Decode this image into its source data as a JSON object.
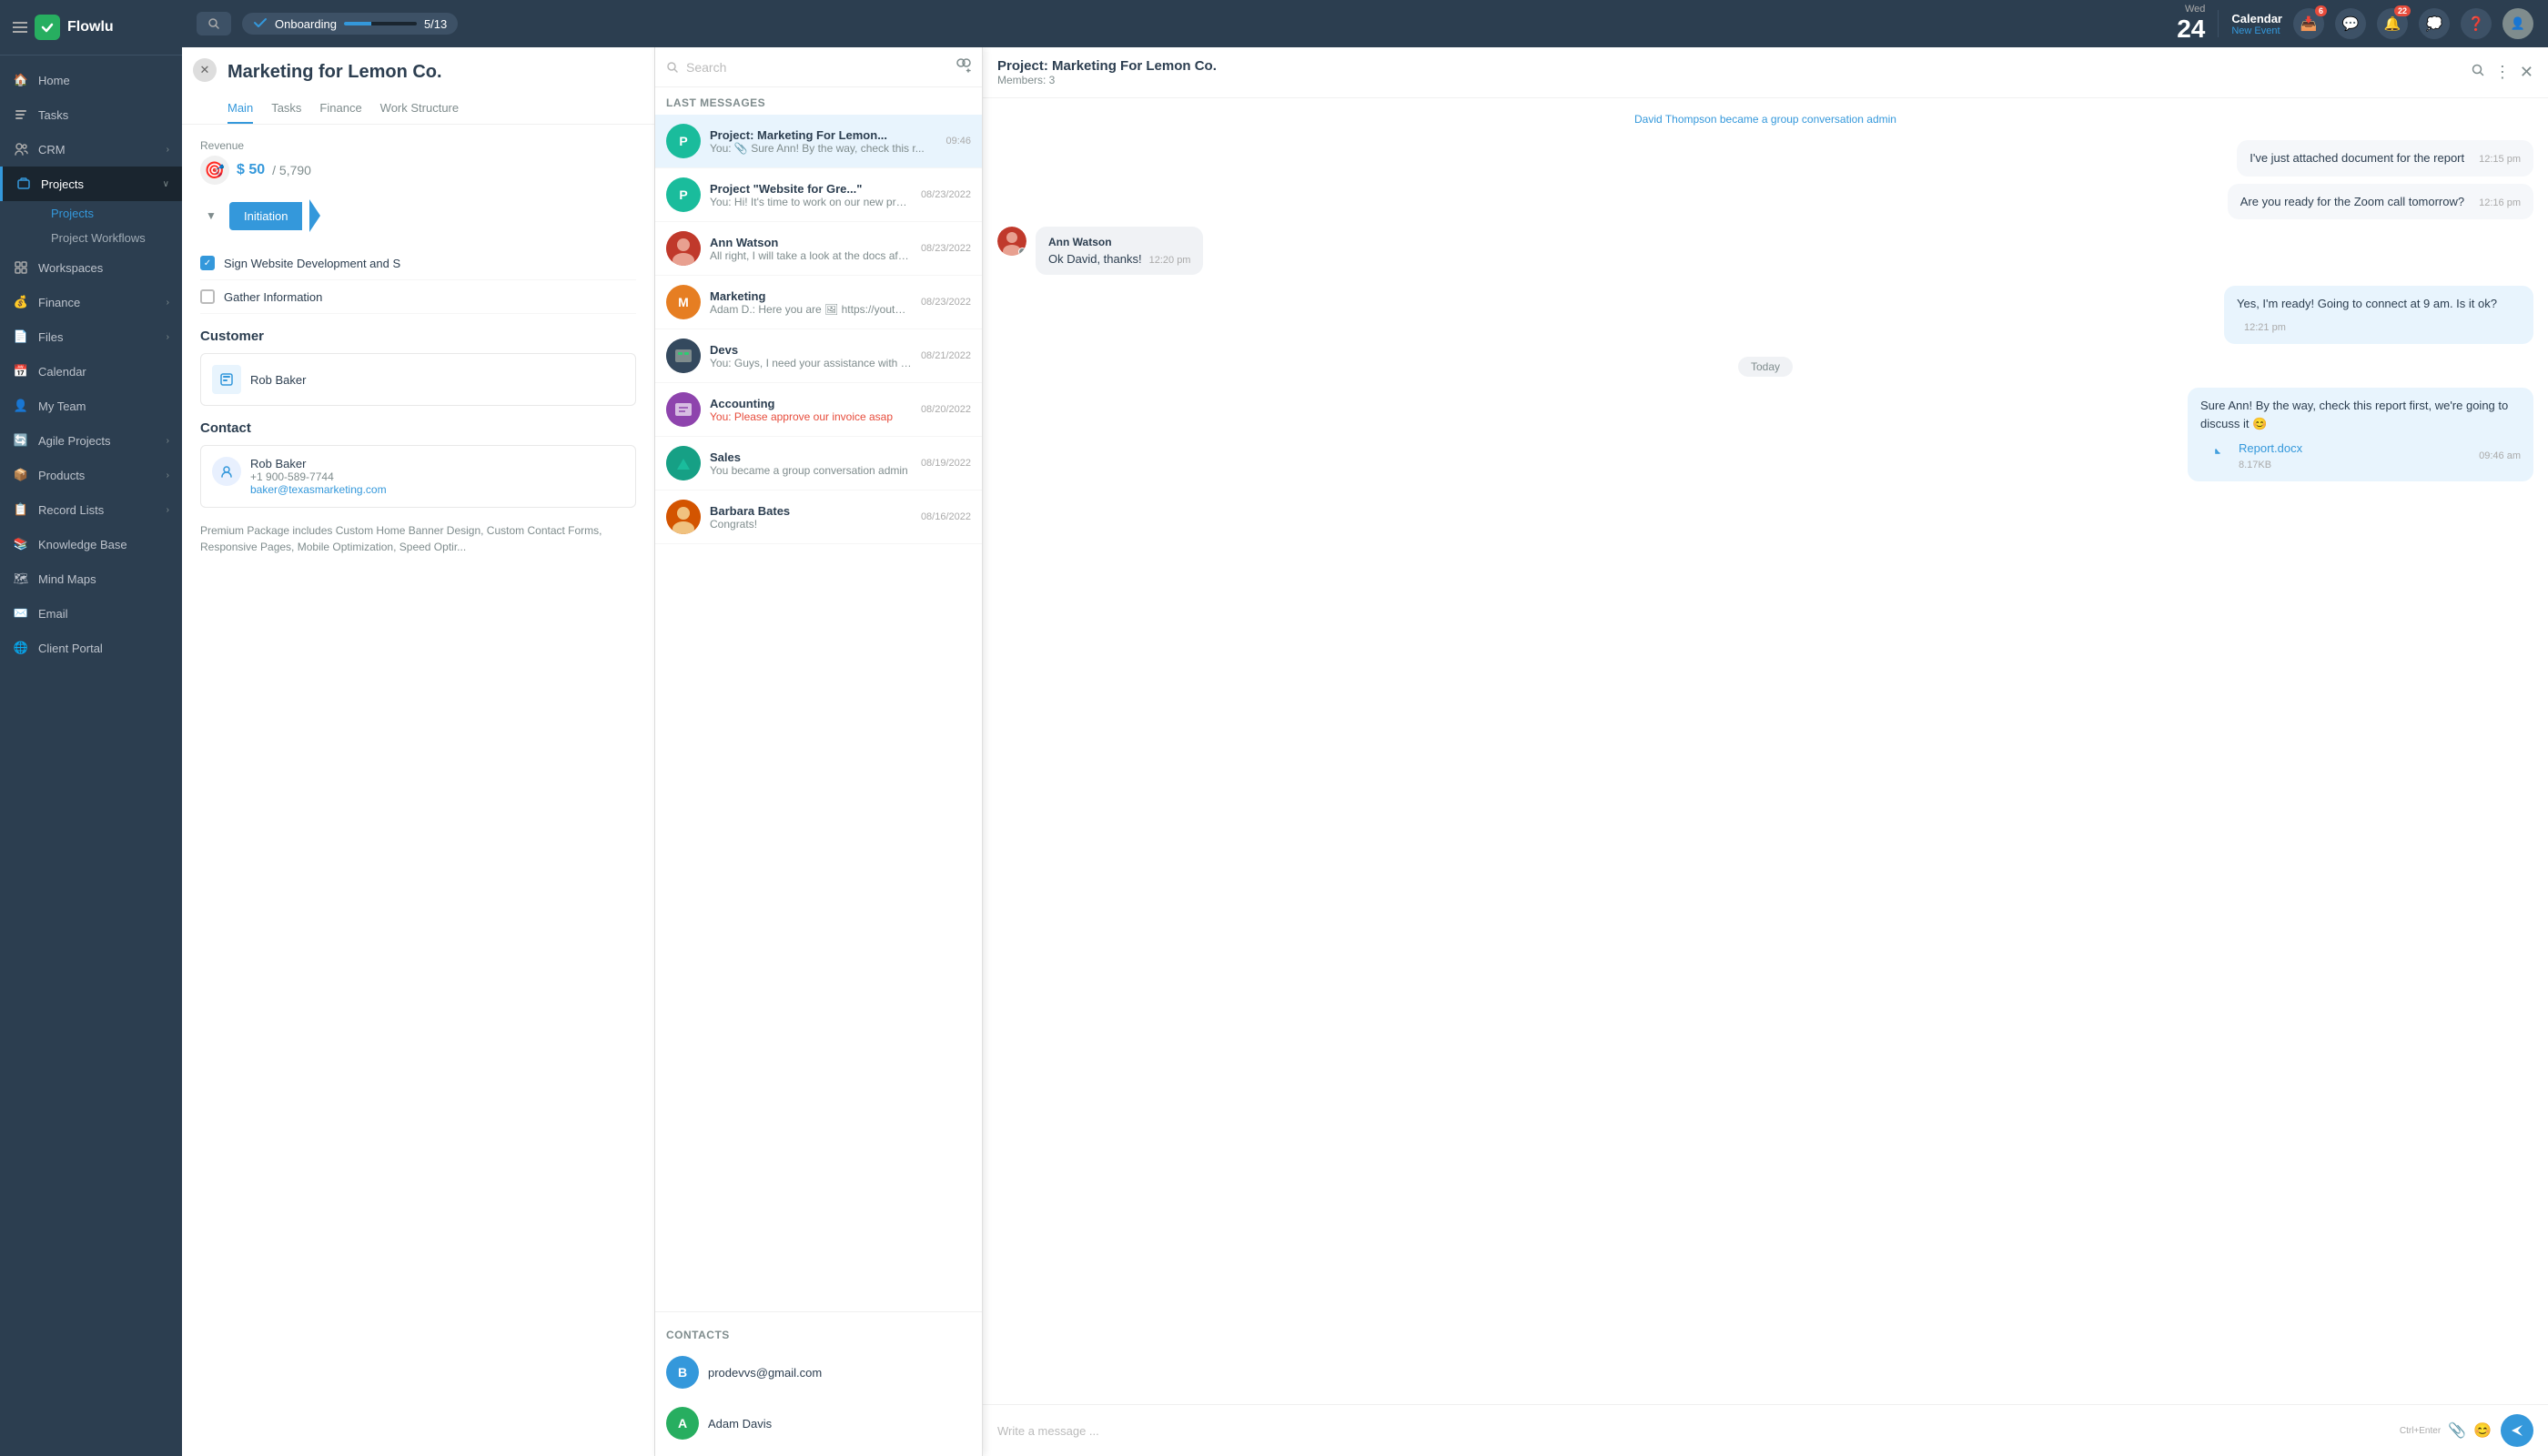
{
  "app": {
    "name": "Flowlu",
    "logo_letter": "✓"
  },
  "topbar": {
    "search_placeholder": "Search",
    "onboarding_label": "Onboarding",
    "onboarding_progress": "5/13",
    "onboarding_pct": 38,
    "calendar_label": "Calendar",
    "calendar_sublabel": "New Event",
    "date_day": "24",
    "date_weekday": "Wed",
    "notif_count": "6",
    "bell_count": "22"
  },
  "sidebar": {
    "items": [
      {
        "id": "home",
        "label": "Home",
        "icon": "🏠"
      },
      {
        "id": "tasks",
        "label": "Tasks",
        "icon": "✓"
      },
      {
        "id": "crm",
        "label": "CRM",
        "icon": "👥"
      },
      {
        "id": "projects",
        "label": "Projects",
        "icon": "📁",
        "active": true,
        "has_sub": true
      },
      {
        "id": "workspaces",
        "label": "Workspaces",
        "icon": "🔲"
      },
      {
        "id": "finance",
        "label": "Finance",
        "icon": "💰"
      },
      {
        "id": "files",
        "label": "Files",
        "icon": "📄"
      },
      {
        "id": "calendar",
        "label": "Calendar",
        "icon": "📅"
      },
      {
        "id": "my-team",
        "label": "My Team",
        "icon": "👤"
      },
      {
        "id": "agile",
        "label": "Agile Projects",
        "icon": "🔄"
      },
      {
        "id": "products",
        "label": "Products",
        "icon": "📦"
      },
      {
        "id": "record-lists",
        "label": "Record Lists",
        "icon": "📋"
      },
      {
        "id": "knowledge-base",
        "label": "Knowledge Base",
        "icon": "📚"
      },
      {
        "id": "mind-maps",
        "label": "Mind Maps",
        "icon": "🗺"
      },
      {
        "id": "email",
        "label": "Email",
        "icon": "✉️"
      },
      {
        "id": "client-portal",
        "label": "Client Portal",
        "icon": "🌐"
      }
    ],
    "sub_items": [
      {
        "id": "projects-sub",
        "label": "Projects",
        "active": false
      },
      {
        "id": "project-workflows",
        "label": "Project Workflows",
        "active": false
      }
    ]
  },
  "project": {
    "title": "Marketing for Lemon Co.",
    "tabs": [
      "Main",
      "Tasks",
      "Finance",
      "Work Structure"
    ],
    "active_tab": "Main",
    "revenue": {
      "label": "Revenue",
      "amount": "$ 50",
      "total": "5,790"
    },
    "stage": "Initiation",
    "tasks": [
      {
        "id": 1,
        "label": "Sign Website Development and S",
        "done": true
      },
      {
        "id": 2,
        "label": "Gather Information",
        "done": false
      }
    ],
    "customer": {
      "label": "Customer",
      "name": "Rob Baker"
    },
    "contact": {
      "label": "Contact",
      "name": "Rob Baker",
      "phone": "+1 900-589-7744",
      "email": "baker@texasmarketing.com"
    },
    "description": "Premium Package includes Custom Home Banner Design, Custom Contact Forms, Responsive Pages, Mobile Optimization, Speed Optir..."
  },
  "messaging": {
    "search_placeholder": "Search",
    "section_label": "Last messages",
    "conversations": [
      {
        "id": 1,
        "name": "Project: Marketing For Lemon...",
        "time": "09:46",
        "preview": "You: 📎 Sure Ann! By the way, check this r...",
        "avatar_letter": "P",
        "avatar_color": "av-teal",
        "active": true
      },
      {
        "id": 2,
        "name": "Project \"Website for Gre...\"",
        "time": "08/23/2022",
        "preview": "You: Hi! It's time to work on our new project!",
        "avatar_letter": "P",
        "avatar_color": "av-teal",
        "active": false
      },
      {
        "id": 3,
        "name": "Ann Watson",
        "time": "08/23/2022",
        "preview": "All right, I will take a look at the docs after ...",
        "avatar_type": "image",
        "active": false
      },
      {
        "id": 4,
        "name": "Marketing",
        "time": "08/23/2022",
        "preview": "Adam D.: Here you are 🖼 https://youtu.b...",
        "avatar_letter": "M",
        "avatar_color": "av-orange",
        "active": false
      },
      {
        "id": 5,
        "name": "Devs",
        "time": "08/21/2022",
        "preview": "You: Guys, I need your assistance with the...",
        "avatar_type": "devs_image",
        "active": false
      },
      {
        "id": 6,
        "name": "Accounting",
        "time": "08/20/2022",
        "preview": "You: Please approve our invoice asap",
        "avatar_type": "accounting_image",
        "active": false
      },
      {
        "id": 7,
        "name": "Sales",
        "time": "08/19/2022",
        "preview": "You became a group conversation admin",
        "avatar_type": "sales_image",
        "active": false
      },
      {
        "id": 8,
        "name": "Barbara Bates",
        "time": "08/16/2022",
        "preview": "Congrats!",
        "avatar_type": "barbara_image",
        "active": false
      }
    ],
    "contacts_section": "Contacts",
    "contacts": [
      {
        "id": 1,
        "name": "prodevvs@gmail.com",
        "avatar_letter": "B",
        "avatar_color": "av-blue"
      },
      {
        "id": 2,
        "name": "Adam Davis",
        "avatar_letter": "A",
        "avatar_color": "av-green"
      }
    ]
  },
  "chat": {
    "title": "Project: Marketing For Lemon Co.",
    "subtitle": "Members: 3",
    "admin_notice_user": "David Thompson",
    "admin_notice_text": "became a group conversation admin",
    "messages": [
      {
        "id": 1,
        "text": "I've just attached document for the report",
        "time": "12:15 pm",
        "type": "received_plain"
      },
      {
        "id": 2,
        "text": "Are you ready for the Zoom call tomorrow?",
        "time": "12:16 pm",
        "type": "received_plain"
      },
      {
        "id": 3,
        "sender": "Ann Watson",
        "text": "Ok David, thanks!",
        "time": "12:20 pm",
        "type": "ann"
      },
      {
        "id": 4,
        "text": "Yes, I'm ready! Going to connect at 9 am. Is it ok?",
        "time": "12:21 pm",
        "type": "sent"
      },
      {
        "id": 5,
        "label": "Today",
        "type": "divider"
      },
      {
        "id": 6,
        "text": "Sure Ann! By the way, check this report first, we're going to discuss it 😊",
        "time": "09:46 am",
        "type": "sent",
        "file": {
          "name": "Report.docx",
          "size": "8.17KB",
          "time": "09:46 am"
        }
      }
    ],
    "input_placeholder": "Write a message ...",
    "shortcut": "Ctrl+Enter"
  }
}
